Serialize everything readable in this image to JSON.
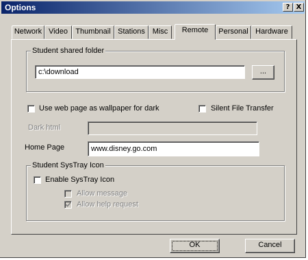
{
  "window": {
    "title": "Options"
  },
  "titlebar_buttons": {
    "help": "?",
    "close": "X"
  },
  "tabs": [
    {
      "label": "Network"
    },
    {
      "label": "Video"
    },
    {
      "label": "Thumbnail"
    },
    {
      "label": "Stations"
    },
    {
      "label": "Misc"
    },
    {
      "label": "Remote",
      "active": true
    },
    {
      "label": "Personal"
    },
    {
      "label": "Hardware"
    }
  ],
  "shared_folder": {
    "legend": "Student shared folder",
    "path": "c:\\download",
    "browse_label": "..."
  },
  "options": {
    "wallpaper_label": "Use web page as wallpaper for dark",
    "wallpaper_checked": false,
    "silent_transfer_label": "Silent File Transfer",
    "silent_transfer_checked": false
  },
  "dark_html": {
    "label": "Dark html",
    "value": ""
  },
  "home_page": {
    "label": "Home Page",
    "value": "www.disney.go.com"
  },
  "systray": {
    "legend": "Student SysTray Icon",
    "enable_label": "Enable SysTray Icon",
    "enable_checked": false,
    "allow_message_label": "Allow message",
    "allow_message_checked": false,
    "allow_help_label": "Allow help request",
    "allow_help_checked": true
  },
  "footer": {
    "ok_label": "OK",
    "cancel_label": "Cancel"
  }
}
